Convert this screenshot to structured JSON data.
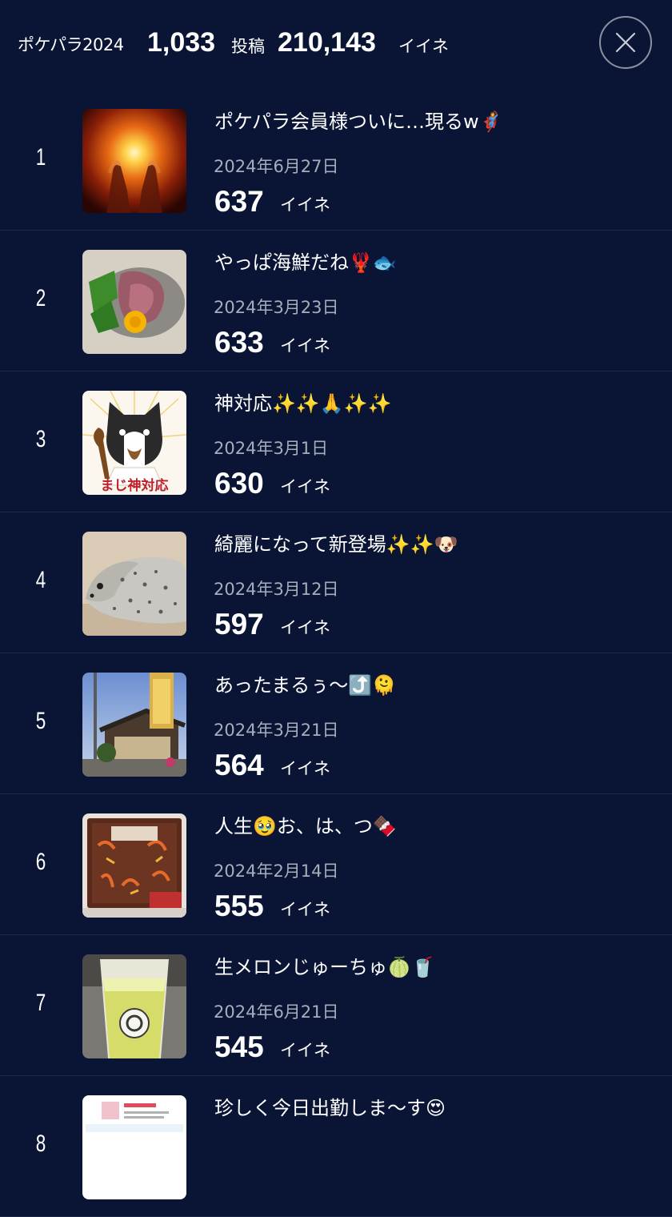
{
  "header": {
    "app_title": "ポケパラ2024",
    "post_count": "1,033",
    "post_unit": "投稿",
    "like_count": "210,143",
    "like_unit": "イイネ"
  },
  "close_icon": "close-icon",
  "colors": {
    "background": "#0a1535",
    "divider": "#1e2a4d",
    "date_text": "#a8adba"
  },
  "posts": [
    {
      "rank": "1",
      "title": "ポケパラ会員様ついに…現るw🦸",
      "date": "2024年6月27日",
      "likes": "637",
      "likes_unit": "イイネ"
    },
    {
      "rank": "2",
      "title": "やっぱ海鮮だね🦞🐟",
      "date": "2024年3月23日",
      "likes": "633",
      "likes_unit": "イイネ"
    },
    {
      "rank": "3",
      "title": "神対応✨✨🙏✨✨",
      "date": "2024年3月1日",
      "likes": "630",
      "likes_unit": "イイネ"
    },
    {
      "rank": "4",
      "title": "綺麗になって新登場✨✨🐶",
      "date": "2024年3月12日",
      "likes": "597",
      "likes_unit": "イイネ"
    },
    {
      "rank": "5",
      "title": "あったまるぅ〜⤴️🫠",
      "date": "2024年3月21日",
      "likes": "564",
      "likes_unit": "イイネ"
    },
    {
      "rank": "6",
      "title": "人生🥹お、は、つ🍫",
      "date": "2024年2月14日",
      "likes": "555",
      "likes_unit": "イイネ"
    },
    {
      "rank": "7",
      "title": "生メロンじゅーちゅ🍈🥤",
      "date": "2024年6月21日",
      "likes": "545",
      "likes_unit": "イイネ"
    },
    {
      "rank": "8",
      "title": "珍しく今日出勤しま〜す😍",
      "date": "",
      "likes": "",
      "likes_unit": ""
    }
  ],
  "thumb3_caption": "まじ神対応"
}
